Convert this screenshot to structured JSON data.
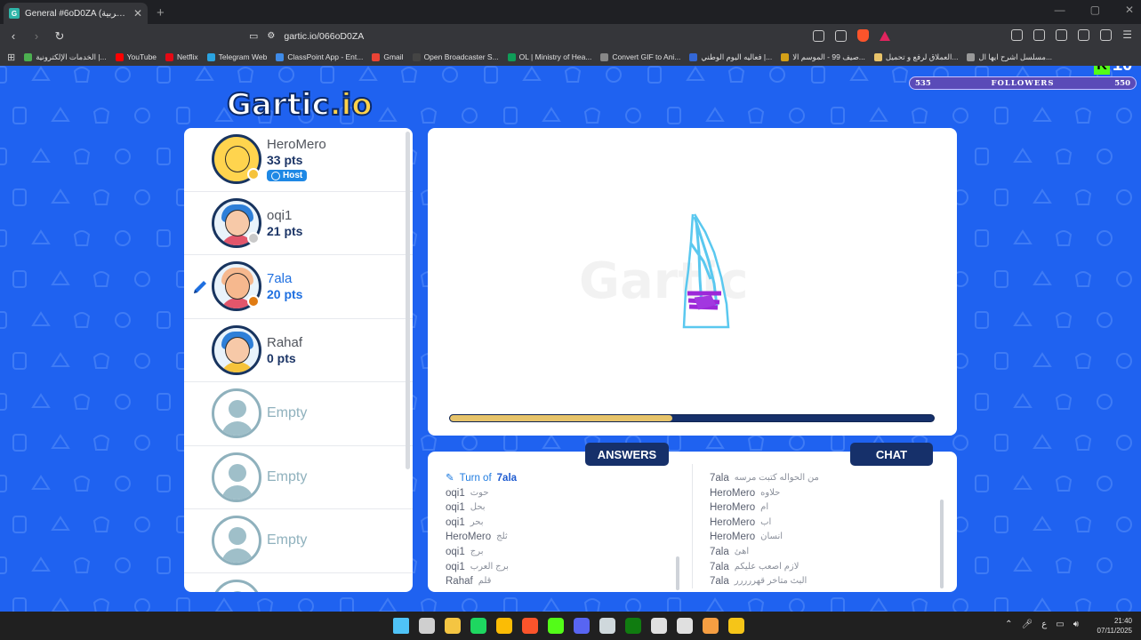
{
  "browser": {
    "tab_title": "General #6oD0ZA (العربية) - Gar",
    "favicon_letter": "G",
    "url": "gartic.io/066oD0ZA",
    "bookmarks": [
      {
        "label": "الخدمات الإلكترونية |...",
        "color": "#4caf50"
      },
      {
        "label": "YouTube",
        "color": "#ff0000"
      },
      {
        "label": "Netflix",
        "color": "#e50914"
      },
      {
        "label": "Telegram Web",
        "color": "#2aa3e0"
      },
      {
        "label": "ClassPoint App - Ent...",
        "color": "#3f8be8"
      },
      {
        "label": "Gmail",
        "color": "#ea4335"
      },
      {
        "label": "Open Broadcaster S...",
        "color": "#444"
      },
      {
        "label": "OL | Ministry of Hea...",
        "color": "#0f9d58"
      },
      {
        "label": "Convert GIF to Ani...",
        "color": "#888"
      },
      {
        "label": "فعاليه اليوم الوطني |...",
        "color": "#3367d6"
      },
      {
        "label": "صيف 99 - الموسم الا...",
        "color": "#d4a017"
      },
      {
        "label": "العملاق لرفع و تحميل...",
        "color": "#e8c36a"
      },
      {
        "label": "مسلسل اشرح ايها ال...",
        "color": "#999"
      }
    ]
  },
  "overlay": {
    "followers_min": "535",
    "followers_label": "FOLLOWERS",
    "followers_max": "550",
    "kick_count": "10"
  },
  "logo": {
    "main": "Gartic",
    "suffix": ".io"
  },
  "players": [
    {
      "name": "HeroMero",
      "pts": "33 pts",
      "host": "Host",
      "status_color": "#f6c33b",
      "skin": "#ffd44e",
      "hair": "#ffd44e",
      "shirt": "#ffd44e",
      "drawing": false
    },
    {
      "name": "oqi1",
      "pts": "21 pts",
      "host": "",
      "status_color": "#c9c9c9",
      "skin": "#f7c9a8",
      "hair": "#2e7fd8",
      "shirt": "#e2566b",
      "drawing": false
    },
    {
      "name": "7ala",
      "pts": "20 pts",
      "host": "",
      "status_color": "#e07b12",
      "skin": "#f6b88e",
      "hair": "#f6b88e",
      "shirt": "#e2566b",
      "drawing": true
    },
    {
      "name": "Rahaf",
      "pts": "0 pts",
      "host": "",
      "status_color": "",
      "skin": "#f7c9a8",
      "hair": "#2e7fd8",
      "shirt": "#f6c33b",
      "drawing": false
    }
  ],
  "empty_slots": [
    "Empty",
    "Empty",
    "Empty"
  ],
  "timer": {
    "progress": 0.46
  },
  "answers_tab": "ANSWERS",
  "chat_tab": "CHAT",
  "turn": {
    "prefix": "Turn of",
    "player": "7ala"
  },
  "answers": [
    {
      "name": "oqi1",
      "text": "حوت"
    },
    {
      "name": "oqi1",
      "text": "بحل"
    },
    {
      "name": "oqi1",
      "text": "بحر"
    },
    {
      "name": "HeroMero",
      "text": "ثلج"
    },
    {
      "name": "oqi1",
      "text": "برج"
    },
    {
      "name": "oqi1",
      "text": "برج العرب"
    },
    {
      "name": "Rahaf",
      "text": "قلم"
    }
  ],
  "chat": [
    {
      "name": "7ala",
      "text": "من الحواله كتبت مرسه"
    },
    {
      "name": "HeroMero",
      "text": "حلاوه"
    },
    {
      "name": "HeroMero",
      "text": "ام"
    },
    {
      "name": "HeroMero",
      "text": "اب"
    },
    {
      "name": "HeroMero",
      "text": "انسان"
    },
    {
      "name": "7ala",
      "text": "اهئ"
    },
    {
      "name": "7ala",
      "text": "لازم اصعب عليكم"
    },
    {
      "name": "7ala",
      "text": "البث متاخر قهررررر"
    }
  ],
  "clock": {
    "time": "21:40",
    "date": "07/11/2025",
    "lang": "ع"
  }
}
